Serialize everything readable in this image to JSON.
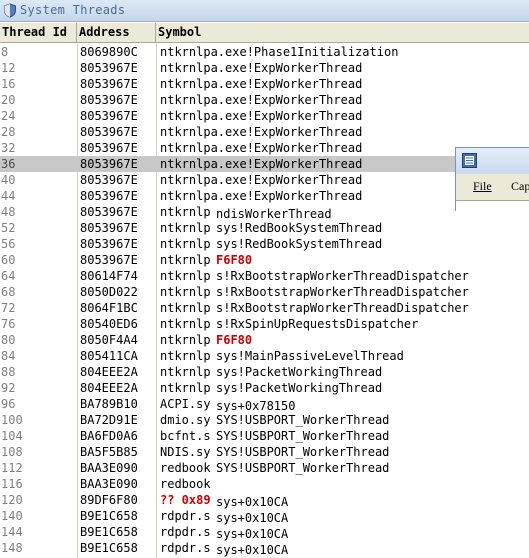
{
  "window": {
    "title": "System Threads"
  },
  "columns": {
    "thread_id": "Thread Id",
    "address": "Address",
    "symbol": "Symbol"
  },
  "rows": [
    {
      "tid": "8",
      "address": "8069890C",
      "symbol": "ntkrnlpa.exe!Phase1Initialization"
    },
    {
      "tid": "12",
      "address": "8053967E",
      "symbol": "ntkrnlpa.exe!ExpWorkerThread"
    },
    {
      "tid": "16",
      "address": "8053967E",
      "symbol": "ntkrnlpa.exe!ExpWorkerThread"
    },
    {
      "tid": "20",
      "address": "8053967E",
      "symbol": "ntkrnlpa.exe!ExpWorkerThread"
    },
    {
      "tid": "24",
      "address": "8053967E",
      "symbol": "ntkrnlpa.exe!ExpWorkerThread"
    },
    {
      "tid": "28",
      "address": "8053967E",
      "symbol": "ntkrnlpa.exe!ExpWorkerThread"
    },
    {
      "tid": "32",
      "address": "8053967E",
      "symbol": "ntkrnlpa.exe!ExpWorkerThread"
    },
    {
      "tid": "36",
      "address": "8053967E",
      "symbol": "ntkrnlpa.exe!ExpWorkerThread",
      "selected": true
    },
    {
      "tid": "40",
      "address": "8053967E",
      "symbol": "ntkrnlpa.exe!ExpWorkerThread"
    },
    {
      "tid": "44",
      "address": "8053967E",
      "symbol": "ntkrnlpa.exe!ExpWorkerThread"
    },
    {
      "tid": "48",
      "address": "8053967E",
      "symbol": "ntkrnlp",
      "overlay": "ndisWorkerThread",
      "overlay_shift": true
    },
    {
      "tid": "52",
      "address": "8053967E",
      "symbol": "ntkrnlp",
      "overlay": "sys!RedBookSystemThread"
    },
    {
      "tid": "56",
      "address": "8053967E",
      "symbol": "ntkrnlp",
      "overlay": "sys!RedBookSystemThread"
    },
    {
      "tid": "60",
      "address": "8053967E",
      "symbol": "ntkrnlp",
      "overlay": "F6F80",
      "overlay_red": true
    },
    {
      "tid": "64",
      "address": "80614F74",
      "symbol": "ntkrnlp",
      "overlay": "s!RxBootstrapWorkerThreadDispatcher"
    },
    {
      "tid": "68",
      "address": "8050D022",
      "symbol": "ntkrnlp",
      "overlay": "s!RxBootstrapWorkerThreadDispatcher"
    },
    {
      "tid": "72",
      "address": "8064F1BC",
      "symbol": "ntkrnlp",
      "overlay": "s!RxBootstrapWorkerThreadDispatcher"
    },
    {
      "tid": "76",
      "address": "80540ED6",
      "symbol": "ntkrnlp",
      "overlay": "s!RxSpinUpRequestsDispatcher"
    },
    {
      "tid": "80",
      "address": "8050F4A4",
      "symbol": "ntkrnlp",
      "overlay": "F6F80",
      "overlay_red": true
    },
    {
      "tid": "84",
      "address": "805411CA",
      "symbol": "ntkrnlp",
      "overlay": "sys!MainPassiveLevelThread"
    },
    {
      "tid": "88",
      "address": "804EEE2A",
      "symbol": "ntkrnlp",
      "overlay": "sys!PacketWorkingThread"
    },
    {
      "tid": "92",
      "address": "804EEE2A",
      "symbol": "ntkrnlp",
      "overlay": "sys!PacketWorkingThread"
    },
    {
      "tid": "96",
      "address": "BA789B10",
      "symbol": "ACPI.sy",
      "overlay": "sys+0x78150",
      "overlay_shift": true
    },
    {
      "tid": "100",
      "address": "BA72D91E",
      "symbol": "dmio.sy",
      "overlay": "SYS!USBPORT_WorkerThread"
    },
    {
      "tid": "104",
      "address": "BA6FD0A6",
      "symbol": "bcfnt.s",
      "overlay": "SYS!USBPORT_WorkerThread"
    },
    {
      "tid": "108",
      "address": "BA5F5B85",
      "symbol": "NDIS.sy",
      "overlay": "SYS!USBPORT_WorkerThread"
    },
    {
      "tid": "112",
      "address": "BAA3E090",
      "symbol": "redbook",
      "overlay": "SYS!USBPORT_WorkerThread"
    },
    {
      "tid": "116",
      "address": "BAA3E090",
      "symbol": "redbook",
      "overlay": "",
      "overlay_shift": true
    },
    {
      "tid": "120",
      "address": "89DF6F80",
      "symbol": "?? 0x89",
      "symbol_red": true,
      "overlay": "sys+0x10CA",
      "overlay_shift": true
    },
    {
      "tid": "140",
      "address": "B9E1C658",
      "symbol": "rdpdr.s",
      "overlay": "sys+0x10CA",
      "overlay_shift": true
    },
    {
      "tid": "144",
      "address": "B9E1C658",
      "symbol": "rdpdr.s",
      "overlay": "sys+0x10CA",
      "overlay_shift": true
    },
    {
      "tid": "148",
      "address": "B9E1C658",
      "symbol": "rdpdr.s",
      "overlay": "sys+0x10CA",
      "overlay_shift": true
    }
  ],
  "popup": {
    "menu": [
      "File",
      "Cap"
    ]
  },
  "colors": {
    "title_text": "#4d6b8f",
    "tid_text": "#7f7f7f",
    "selected_row": "#c8c8c8",
    "header_bg": "#ece9d8",
    "error_red": "#cc0000"
  },
  "icons": {
    "title": "shield-icon",
    "popup": "window-app-icon"
  }
}
